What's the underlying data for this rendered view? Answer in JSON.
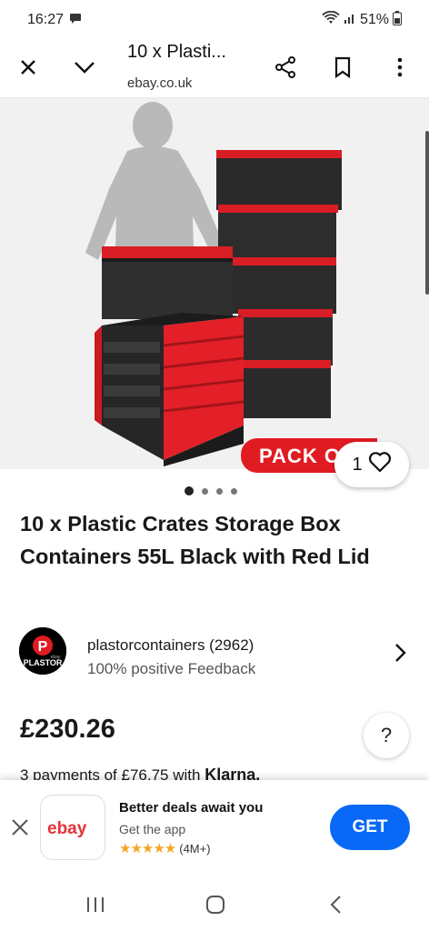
{
  "status": {
    "time": "16:27",
    "battery": "51%"
  },
  "header": {
    "title": "10 x Plasti...",
    "domain": "ebay.co.uk"
  },
  "hero": {
    "badge_text": "PACK O",
    "watch_count": "1"
  },
  "carousel": {
    "total": 4,
    "active": 0
  },
  "product": {
    "title": "10 x Plastic Crates Storage Box Containers 55L Black with Red Lid"
  },
  "seller": {
    "name": "plastorcontainers (2962)",
    "feedback": "100% positive Feedback",
    "logo_letter": "P",
    "logo_text": "PLASTOR",
    "logo_small": "ebay"
  },
  "price": {
    "amount": "£230.26",
    "help_label": "?"
  },
  "klarna": {
    "text": "3 payments of £76.75 with",
    "brand": "Klarna."
  },
  "banner": {
    "headline": "Better deals await you",
    "subtitle": "Get the app",
    "rating": "(4M+)",
    "get_label": "GET",
    "app_name": "ebay"
  },
  "colors": {
    "accent": "#0968f6",
    "brand_red": "#e11b22",
    "crate_black": "#2a2a2a",
    "star": "#f5a623"
  }
}
